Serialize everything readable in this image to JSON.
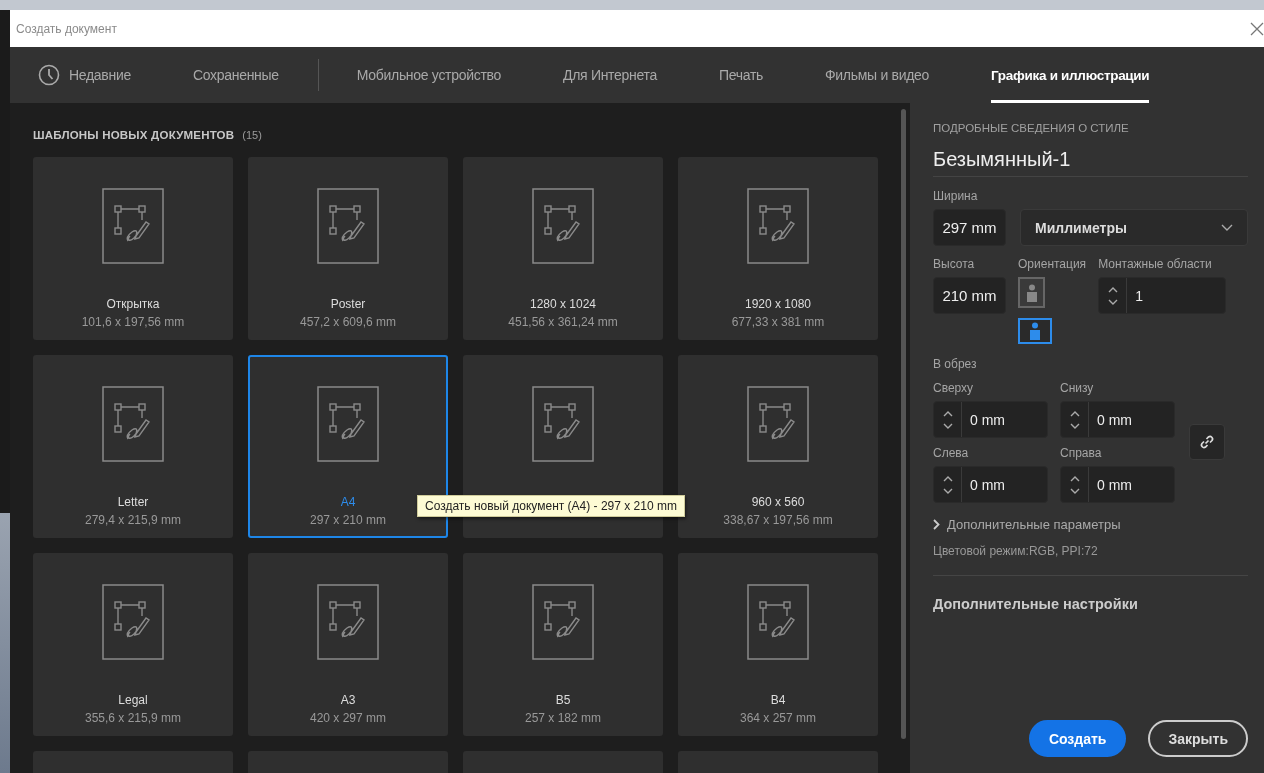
{
  "window": {
    "title": "Создать документ"
  },
  "tabs": [
    {
      "label": "Недавние",
      "selected": false,
      "kind": "recent"
    },
    {
      "label": "Сохраненные",
      "selected": false,
      "kind": "plain"
    },
    {
      "label": "Мобильное устройство",
      "selected": false,
      "kind": "plain"
    },
    {
      "label": "Для Интернета",
      "selected": false,
      "kind": "plain"
    },
    {
      "label": "Печать",
      "selected": false,
      "kind": "plain"
    },
    {
      "label": "Фильмы и видео",
      "selected": false,
      "kind": "plain"
    },
    {
      "label": "Графика и иллюстрации",
      "selected": true,
      "kind": "plain"
    }
  ],
  "templates": {
    "heading": "ШАБЛОНЫ НОВЫХ ДОКУМЕНТОВ",
    "count": "(15)",
    "cards": [
      {
        "name": "Открытка",
        "size": "101,6 x 197,56 mm",
        "selected": false
      },
      {
        "name": "Poster",
        "size": "457,2 x 609,6 mm",
        "selected": false
      },
      {
        "name": "1280 x 1024",
        "size": "451,56 x 361,24 mm",
        "selected": false
      },
      {
        "name": "1920 x 1080",
        "size": "677,33 x 381 mm",
        "selected": false
      },
      {
        "name": "Letter",
        "size": "279,4 x 215,9 mm",
        "selected": false
      },
      {
        "name": "A4",
        "size": "297 x 210 mm",
        "selected": true
      },
      {
        "selected": false
      },
      {
        "name": "960 x 560",
        "size": "338,67 x 197,56 mm",
        "selected": false
      },
      {
        "name": "Legal",
        "size": "355,6 x 215,9 mm",
        "selected": false
      },
      {
        "name": "A3",
        "size": "420 x 297 mm",
        "selected": false
      },
      {
        "name": "B5",
        "size": "257 x 182 mm",
        "selected": false
      },
      {
        "name": "B4",
        "size": "364 x 257 mm",
        "selected": false
      },
      {
        "selected": false
      },
      {
        "selected": false
      },
      {
        "selected": false
      },
      {
        "selected": false
      }
    ],
    "tooltip": "Создать новый документ (A4) - 297 x 210 mm"
  },
  "details": {
    "heading": "ПОДРОБНЫЕ СВЕДЕНИЯ О СТИЛЕ",
    "name": "Безымянный-1",
    "width_label": "Ширина",
    "width": "297 mm",
    "units": "Миллиметры",
    "height_label": "Высота",
    "height": "210 mm",
    "orientation_label": "Ориентация",
    "orientations": [
      {
        "kind": "portrait",
        "selected": false
      },
      {
        "kind": "landscape",
        "selected": true
      }
    ],
    "artboards_label": "Монтажные области",
    "artboards": "1",
    "bleed_label": "В обрез",
    "bleed": [
      {
        "label": "Сверху",
        "value": "0 mm"
      },
      {
        "label": "Снизу",
        "value": "0 mm"
      },
      {
        "label": "Слева",
        "value": "0 mm"
      },
      {
        "label": "Справа",
        "value": "0 mm"
      }
    ],
    "advanced": "Дополнительные параметры",
    "color_info": "Цветовой режим:RGB, PPI:72",
    "more_settings": "Дополнительные настройки"
  },
  "buttons": [
    {
      "label": "Создать",
      "kind": "primary"
    },
    {
      "label": "Закрыть",
      "kind": "secondary"
    }
  ]
}
